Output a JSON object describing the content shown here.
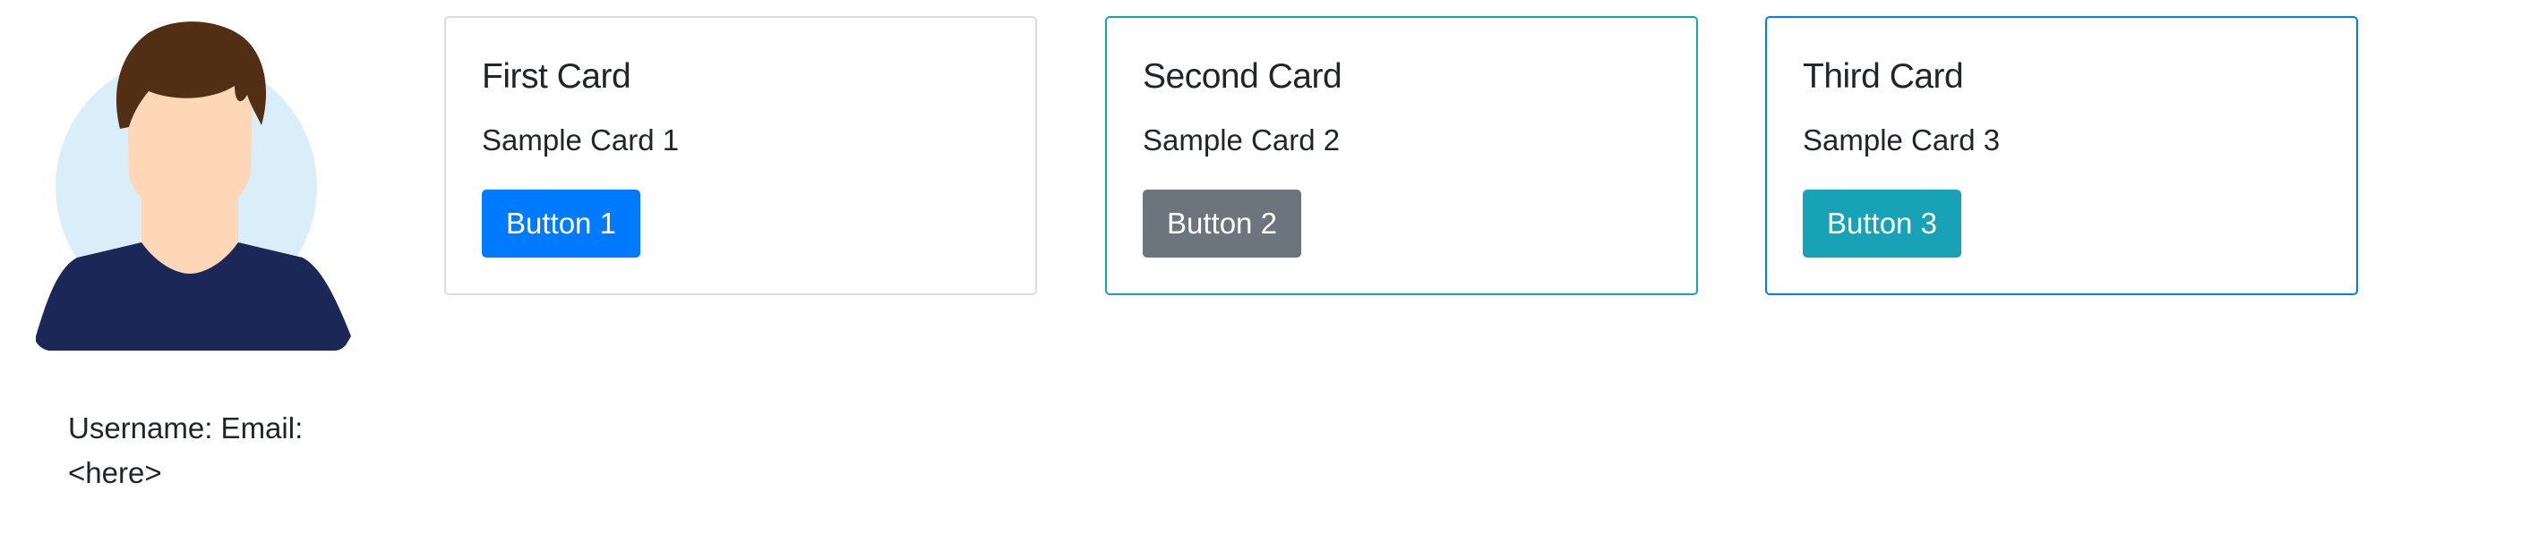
{
  "profile": {
    "username_email_label": "Username: Email:",
    "value_placeholder": "<here>",
    "avatar_icon": "user-avatar-icon"
  },
  "cards": [
    {
      "title": "First Card",
      "text": "Sample Card 1",
      "button_label": "Button 1",
      "border_color": "#dcdcdc",
      "button_color": "#007bff"
    },
    {
      "title": "Second Card",
      "text": "Sample Card 2",
      "button_label": "Button 2",
      "border_color": "#17a2b8",
      "button_color": "#6c757d"
    },
    {
      "title": "Third Card",
      "text": "Sample Card 3",
      "button_label": "Button 3",
      "border_color": "#007bff",
      "button_color": "#17a2b8"
    }
  ]
}
